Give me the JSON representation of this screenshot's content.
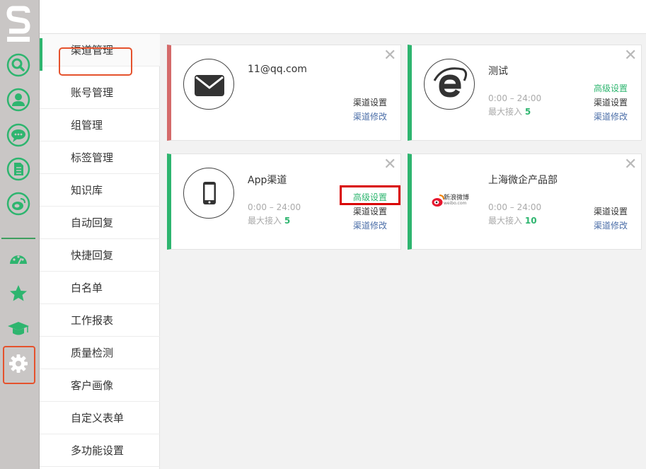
{
  "rail": {
    "items": [
      "search-icon",
      "user-icon",
      "chat-icon",
      "document-icon",
      "weibo-icon",
      "dashboard-icon",
      "star-icon",
      "graduation-icon",
      "gear-icon"
    ],
    "accent": "#2eb56f",
    "highlight": "#e5522d"
  },
  "subnav": {
    "items": [
      "渠道管理",
      "账号管理",
      "组管理",
      "标签管理",
      "知识库",
      "自动回复",
      "快捷回复",
      "白名单",
      "工作报表",
      "质量检测",
      "客户画像",
      "自定义表单",
      "多功能设置"
    ]
  },
  "cards": [
    {
      "title": "11@qq.com",
      "icon": "mail-icon",
      "links": [
        "渠道设置",
        "渠道修改"
      ]
    },
    {
      "title": "测试",
      "icon": "ie-icon",
      "time_label": "0:00 – 24:00",
      "max_label": "最大接入",
      "max_value": "5",
      "links": [
        "高级设置",
        "渠道设置",
        "渠道修改"
      ]
    },
    {
      "title": "App渠道",
      "icon": "phone-icon",
      "time_label": "0:00 – 24:00",
      "max_label": "最大接入",
      "max_value": "5",
      "links": [
        "高级设置",
        "渠道设置",
        "渠道修改"
      ]
    },
    {
      "title": "上海微企产品部",
      "icon": "weibo-logo",
      "logo_text": "新浪微博",
      "logo_sub": "weibo.com",
      "time_label": "0:00 – 24:00",
      "max_label": "最大接入",
      "max_value": "10",
      "links": [
        "渠道设置",
        "渠道修改"
      ]
    }
  ],
  "close_glyph": "✕"
}
